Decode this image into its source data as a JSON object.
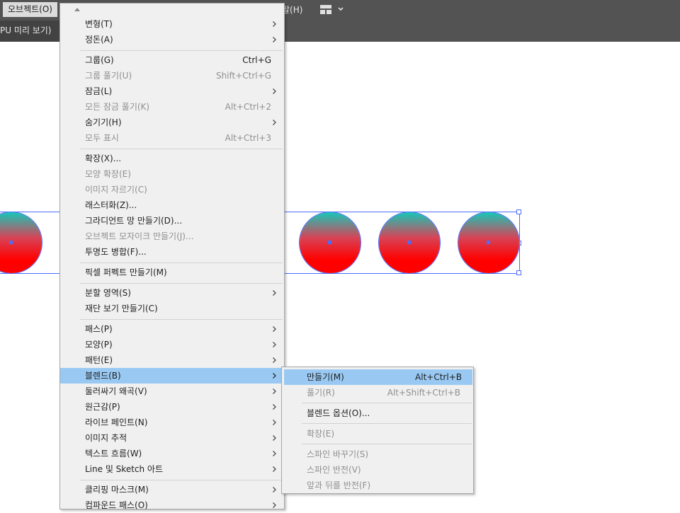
{
  "menubar": {
    "active_menu": "오브젝트(O)",
    "help_menu": "말(H)",
    "workspace_icon": "grid-layout-icon",
    "chevron_icon": "chevron-down-icon"
  },
  "tabbar": {
    "doc_tab": "PU 미리 보기)"
  },
  "colors": {
    "highlight": "#99c9f2",
    "selection": "#4a6cff",
    "gradient_top": "#16c7b7",
    "gradient_bottom": "#ff0000",
    "chrome": "#535353"
  },
  "object_menu": {
    "items": [
      {
        "label": "변형(T)",
        "shortcut": "",
        "submenu": true,
        "disabled": false
      },
      {
        "label": "정돈(A)",
        "shortcut": "",
        "submenu": true,
        "disabled": false
      },
      {
        "label": "그룹(G)",
        "shortcut": "Ctrl+G",
        "submenu": false,
        "disabled": false
      },
      {
        "label": "그룹 풀기(U)",
        "shortcut": "Shift+Ctrl+G",
        "submenu": false,
        "disabled": true
      },
      {
        "label": "잠금(L)",
        "shortcut": "",
        "submenu": true,
        "disabled": false
      },
      {
        "label": "모든 잠금 풀기(K)",
        "shortcut": "Alt+Ctrl+2",
        "submenu": false,
        "disabled": true
      },
      {
        "label": "숨기기(H)",
        "shortcut": "",
        "submenu": true,
        "disabled": false
      },
      {
        "label": "모두 표시",
        "shortcut": "Alt+Ctrl+3",
        "submenu": false,
        "disabled": true
      },
      {
        "label": "확장(X)...",
        "shortcut": "",
        "submenu": false,
        "disabled": false
      },
      {
        "label": "모양 확장(E)",
        "shortcut": "",
        "submenu": false,
        "disabled": true
      },
      {
        "label": "이미지 자르기(C)",
        "shortcut": "",
        "submenu": false,
        "disabled": true
      },
      {
        "label": "래스터화(Z)...",
        "shortcut": "",
        "submenu": false,
        "disabled": false
      },
      {
        "label": "그라디언트 망 만들기(D)...",
        "shortcut": "",
        "submenu": false,
        "disabled": false
      },
      {
        "label": "오브젝트 모자이크 만들기(J)...",
        "shortcut": "",
        "submenu": false,
        "disabled": true
      },
      {
        "label": "투명도 병합(F)...",
        "shortcut": "",
        "submenu": false,
        "disabled": false
      },
      {
        "label": "픽셀 퍼펙트 만들기(M)",
        "shortcut": "",
        "submenu": false,
        "disabled": false
      },
      {
        "label": "분할 영역(S)",
        "shortcut": "",
        "submenu": true,
        "disabled": false
      },
      {
        "label": "재단 보기 만들기(C)",
        "shortcut": "",
        "submenu": false,
        "disabled": false
      },
      {
        "label": "패스(P)",
        "shortcut": "",
        "submenu": true,
        "disabled": false
      },
      {
        "label": "모양(P)",
        "shortcut": "",
        "submenu": true,
        "disabled": false
      },
      {
        "label": "패턴(E)",
        "shortcut": "",
        "submenu": true,
        "disabled": false
      },
      {
        "label": "블렌드(B)",
        "shortcut": "",
        "submenu": true,
        "disabled": false,
        "highlighted": true
      },
      {
        "label": "둘러싸기 왜곡(V)",
        "shortcut": "",
        "submenu": true,
        "disabled": false
      },
      {
        "label": "원근감(P)",
        "shortcut": "",
        "submenu": true,
        "disabled": false
      },
      {
        "label": "라이브 페인트(N)",
        "shortcut": "",
        "submenu": true,
        "disabled": false
      },
      {
        "label": "이미지 추적",
        "shortcut": "",
        "submenu": true,
        "disabled": false
      },
      {
        "label": "텍스트 흐름(W)",
        "shortcut": "",
        "submenu": true,
        "disabled": false
      },
      {
        "label": "Line 및 Sketch 아트",
        "shortcut": "",
        "submenu": true,
        "disabled": false
      },
      {
        "label": "클리핑 마스크(M)",
        "shortcut": "",
        "submenu": true,
        "disabled": false
      },
      {
        "label": "컴파운드 패스(O)",
        "shortcut": "",
        "submenu": true,
        "disabled": false
      }
    ]
  },
  "blend_submenu": {
    "items": [
      {
        "label": "만들기(M)",
        "shortcut": "Alt+Ctrl+B",
        "disabled": false,
        "highlighted": true
      },
      {
        "label": "풀기(R)",
        "shortcut": "Alt+Shift+Ctrl+B",
        "disabled": true
      },
      {
        "label": "블렌드 옵션(O)...",
        "shortcut": "",
        "disabled": false
      },
      {
        "label": "확장(E)",
        "shortcut": "",
        "disabled": true
      },
      {
        "label": "스파인 바꾸기(S)",
        "shortcut": "",
        "disabled": true
      },
      {
        "label": "스파인 반전(V)",
        "shortcut": "",
        "disabled": true
      },
      {
        "label": "앞과 뒤를 반전(F)",
        "shortcut": "",
        "disabled": true
      }
    ]
  }
}
